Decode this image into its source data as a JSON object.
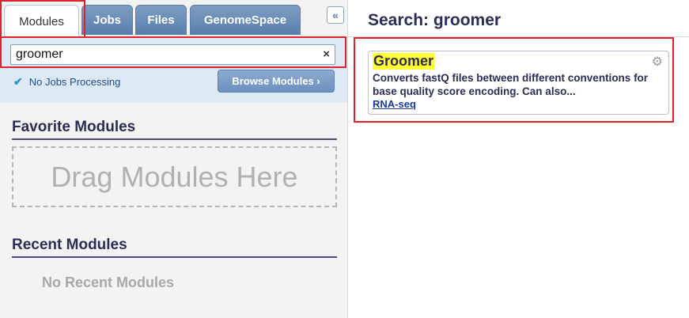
{
  "tabs": [
    {
      "label": "Modules"
    },
    {
      "label": "Jobs"
    },
    {
      "label": "Files"
    },
    {
      "label": "GenomeSpace"
    }
  ],
  "collapse_label": "«",
  "search": {
    "value": "groomer",
    "clear_label": "×"
  },
  "status": {
    "icon": "checkmark-icon",
    "text": "No Jobs Processing"
  },
  "browse_button": "Browse Modules ›",
  "favorites": {
    "title": "Favorite Modules",
    "drop_text": "Drag Modules Here"
  },
  "recent": {
    "title": "Recent Modules",
    "empty_text": "No Recent Modules"
  },
  "results": {
    "title": "Search: groomer",
    "items": [
      {
        "name": "Groomer",
        "description": "Converts fastQ files between different conventions for base quality score encoding. Can also...",
        "tag": "RNA-seq",
        "icon": "gear-icon"
      }
    ]
  },
  "colors": {
    "tab_blue": "#6b8fbe",
    "highlight": "#ffff33",
    "annotation_red": "#e0232b"
  }
}
